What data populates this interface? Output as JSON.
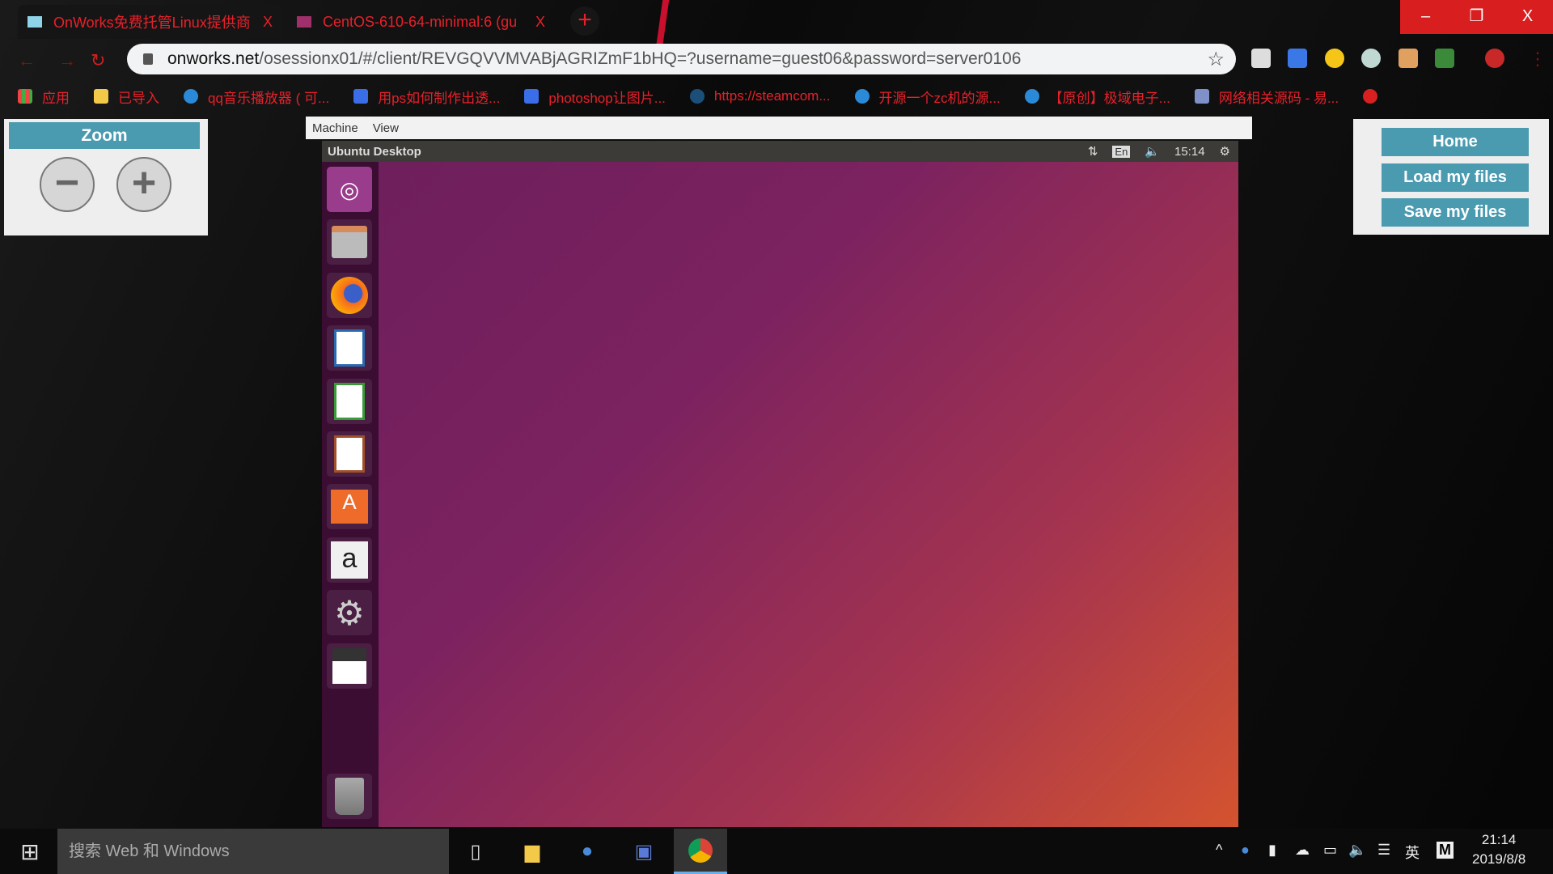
{
  "browser": {
    "tabs": [
      {
        "title": "OnWorks免费托管Linux提供商",
        "active": true
      },
      {
        "title": "CentOS-610-64-minimal:6 (gu",
        "active": false
      }
    ],
    "tab_close": "X",
    "new_tab": "+",
    "window_controls": {
      "minimize": "–",
      "restore": "❐",
      "close": "X"
    },
    "url": {
      "host": "onworks.net",
      "path": "/osessionx01/#/client/REVGQVVMVABjAGRIZmF1bHQ=?username=guest06&password=server0106"
    },
    "bookmarks": [
      "应用",
      "已导入",
      "qq音乐播放器 ( 可...",
      "用ps如何制作出透...",
      "photoshop让图片...",
      "https://steamcom...",
      "开源一个zc机的源...",
      "【原创】极域电子...",
      "网络相关源码 - 易..."
    ],
    "accent": "#e8202a"
  },
  "zoom_panel": {
    "title": "Zoom",
    "minus": "−",
    "plus": "+"
  },
  "right_panel": {
    "home": "Home",
    "load": "Load my files",
    "save": "Save my files",
    "button_color": "#4a9ab0"
  },
  "vm": {
    "menu": [
      "Machine",
      "View"
    ],
    "topbar": {
      "title": "Ubuntu Desktop",
      "lang": "En",
      "time": "15:14"
    },
    "launcher": [
      "ubuntu-dash",
      "files",
      "firefox",
      "writer",
      "calc",
      "impress",
      "software-center",
      "amazon",
      "system-settings",
      "save-disk",
      "trash"
    ]
  },
  "taskbar": {
    "search_placeholder": "搜索 Web 和 Windows",
    "ime": "英",
    "time": "21:14",
    "date": "2019/8/8"
  }
}
